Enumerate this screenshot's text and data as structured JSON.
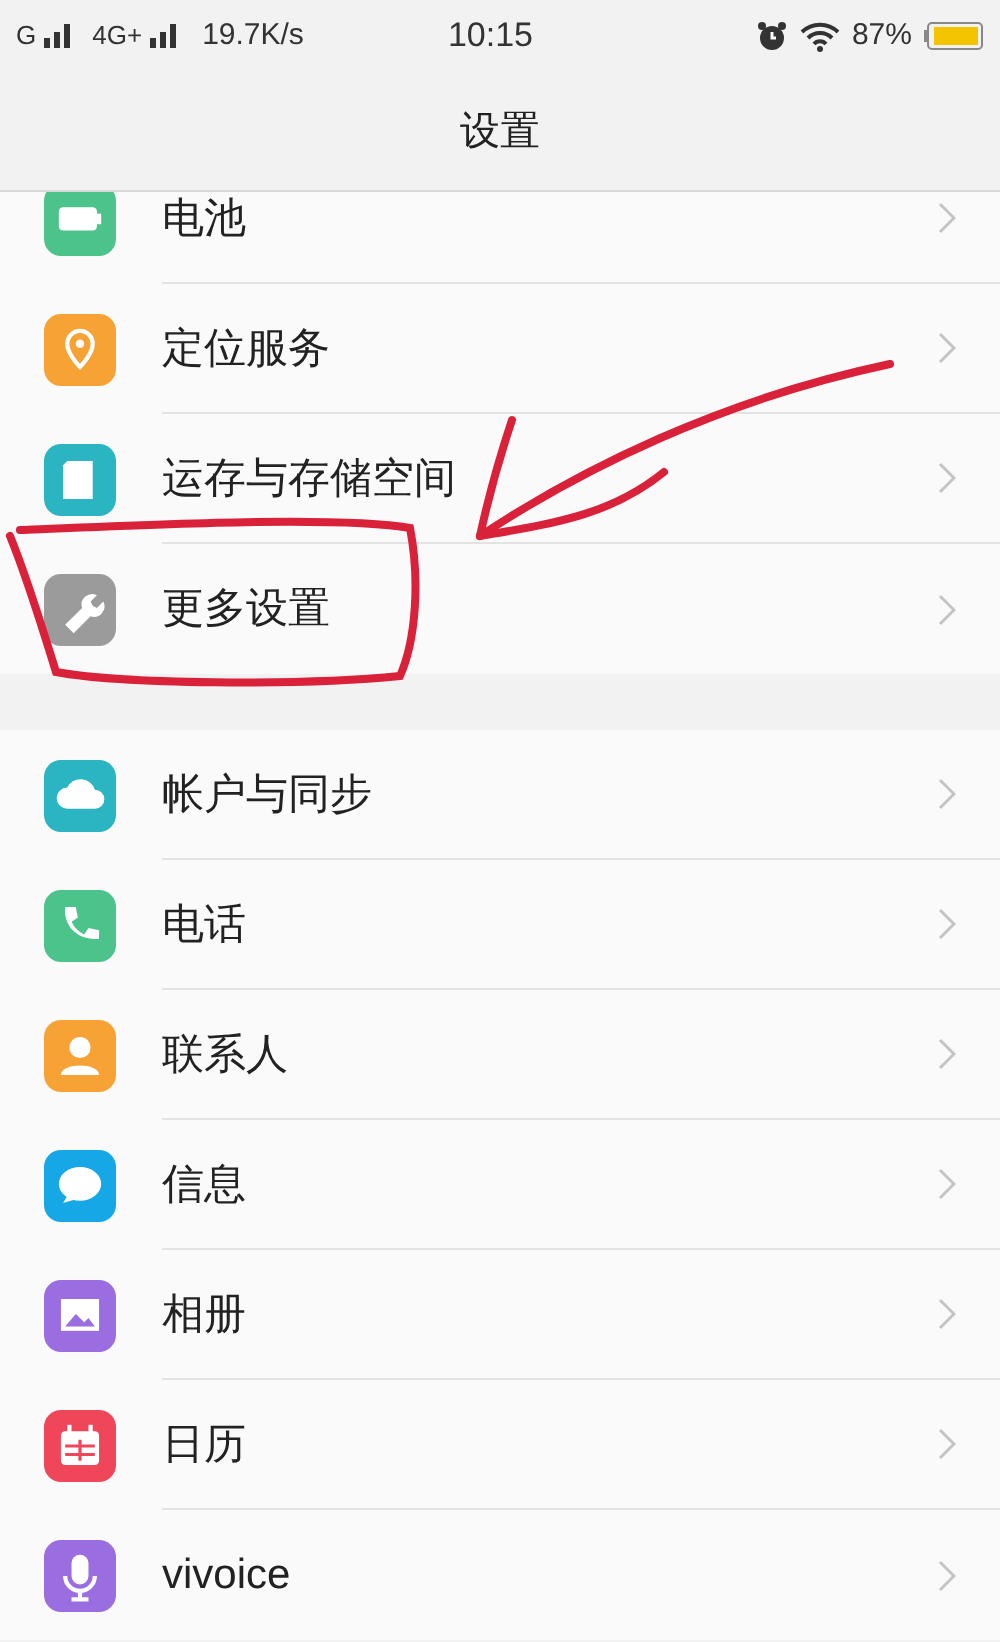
{
  "status_bar": {
    "carrier_1": "G",
    "carrier_2": "4G+",
    "speed": "19.7K/s",
    "time": "10:15",
    "battery": "87%"
  },
  "header": {
    "title": "设置"
  },
  "groups": [
    {
      "items": [
        {
          "label": "电池",
          "color": "#4cc38a"
        },
        {
          "label": "定位服务",
          "color": "#f7a234"
        },
        {
          "label": "运存与存储空间",
          "color": "#2bb5c2"
        },
        {
          "label": "更多设置",
          "color": "#9b9b9b"
        }
      ]
    },
    {
      "items": [
        {
          "label": "帐户与同步",
          "color": "#2bb5c2"
        },
        {
          "label": "电话",
          "color": "#4cc38a"
        },
        {
          "label": "联系人",
          "color": "#f7a234"
        },
        {
          "label": "信息",
          "color": "#16a8e6"
        },
        {
          "label": "相册",
          "color": "#9a6de0"
        },
        {
          "label": "日历",
          "color": "#f0465a"
        },
        {
          "label": "vivoice",
          "color": "#9a6de0"
        }
      ]
    }
  ]
}
